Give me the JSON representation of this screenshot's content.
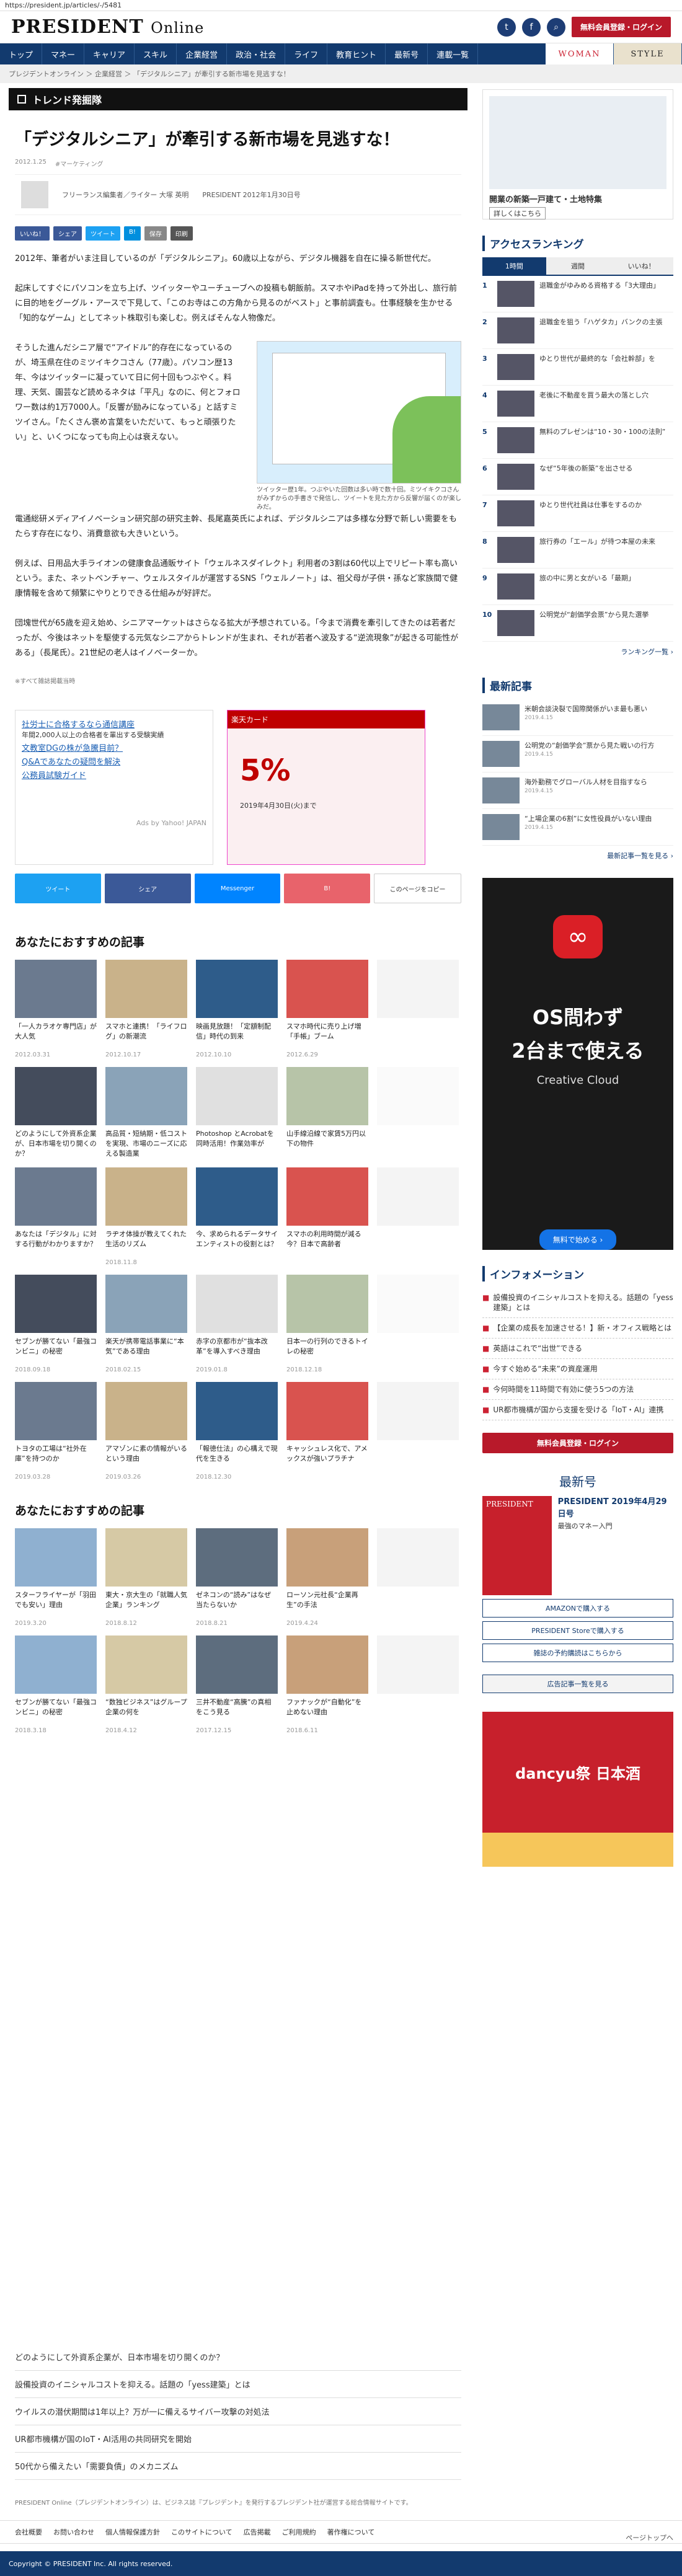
{
  "url": "https://president.jp/articles/-/5481",
  "header": {
    "logo": "PRESIDENT",
    "logo_sub": "Online",
    "login_label": "無料会員登録・ログイン"
  },
  "nav": {
    "items": [
      "トップ",
      "マネー",
      "キャリア",
      "スキル",
      "企業経営",
      "政治・社会",
      "ライフ",
      "教育ヒント",
      "最新号",
      "連載一覧"
    ],
    "woman": "WOMAN",
    "style": "STYLE"
  },
  "breadcrumb": "プレジデントオンライン ＞ 企業経営 ＞ 「デジタルシニア」が牽引する新市場を見逃すな！",
  "section_label": "トレンド発掘隊",
  "article": {
    "title": "「デジタルシニア」が牽引する新市場を見逃すな！",
    "date": "2012.1.25",
    "category": "#マーケティング",
    "author": "フリーランス編集者／ライター 大塚 英明",
    "source": "PRESIDENT 2012年1月30日号",
    "share": [
      "いいね！",
      "シェア",
      "ツイート",
      "B!",
      "保存",
      "印刷"
    ],
    "paragraphs": [
      "2012年、筆者がいま注目しているのが「デジタルシニア」。60歳以上ながら、デジタル機器を自在に操る新世代だ。",
      "起床してすぐにパソコンを立ち上げ、ツイッターやユーチューブへの投稿も朝飯前。スマホやiPadを持って外出し、旅行前に目的地をグーグル・アースで下見して、「このお寺はこの方角から見るのがベスト」と事前調査も。仕事経験を生かせる「知的なゲーム」としてネット株取引も楽しむ。例えばそんな人物像だ。",
      "そうした進んだシニア層で“アイドル”的存在になっているのが、埼玉県在住のミツイキクコさん（77歳）。パソコン歴13年、今はツイッターに凝っていて日に何十回もつぶやく。料理、天気、園芸など読めるネタは「平凡」なのに、何とフォロワー数は約1万7000人。「反響が励みになっている」と話すミツイさん。「たくさん褒め言葉をいただいて、もっと頑張りたい」と、いくつになっても向上心は衰えない。",
      "電通総研メディアイノベーション研究部の研究主幹、長尾嘉英氏によれば、デジタルシニアは多様な分野で新しい需要をもたらす存在になり、消費意欲も大きいという。",
      "例えば、日用品大手ライオンの健康食品通販サイト「ウェルネスダイレクト」利用者の3割は60代以上でリピート率も高いという。また、ネットベンチャー、ウェルスタイルが運営するSNS「ウェルノート」は、祖父母が子供・孫など家族間で健康情報を含めて頻繁にやりとりできる仕組みが好評だ。",
      "団塊世代が65歳を迎え始め、シニアマーケットはさらなる拡大が予想されている。「今まで消費を牽引してきたのは若者だったが、今後はネットを駆使する元気なシニアからトレンドが生まれ、それが若者へ波及する“逆流現象”が起きる可能性がある」（長尾氏）。21世紀の老人はイノベーターか。"
    ],
    "figure_caption": "ツイッター歴1年。つぶやいた回数は多い時で数十回。ミツイキクコさんがみずからの手書きで発信し、ツイートを見た方から反響が届くのが楽しみだ。",
    "note": "※すべて雑誌掲載当時"
  },
  "ads": {
    "ad1_lines": [
      "社労士に合格するなら通信講座",
      "年間2,000人以上の合格者を輩出する受験実績",
      "文教室DGの株が急騰目前？",
      "Q&Aであなたの疑問を解決",
      "公務員試験ガイド",
      "Ads by Yahoo! JAPAN"
    ],
    "ad2_title": "楽天カード",
    "ad2_offer": "5%",
    "ad2_date": "2019年4月30日(火)まで"
  },
  "sharebar": [
    "ツイート",
    "シェア",
    "Messenger",
    "B!",
    "このページをコピー"
  ],
  "rec1": {
    "title": "あなたにおすすめの記事",
    "cards": [
      {
        "t": "「一人カラオケ専門店」が大人気",
        "d": "2012.03.31"
      },
      {
        "t": "スマホと連携！「ライフログ」の新潮流",
        "d": "2012.10.17"
      },
      {
        "t": "映画見放題！「定額制配信」時代の到来",
        "d": "2012.10.10"
      },
      {
        "t": "スマホ時代に売り上げ増「手帳」ブーム",
        "d": "2012.6.29"
      },
      {
        "t": "",
        "d": ""
      },
      {
        "t": "どのようにして外資系企業が、日本市場を切り開くのか？",
        "d": ""
      },
      {
        "t": "高品質・短納期・低コストを実現、市場のニーズに応える製造業",
        "d": ""
      },
      {
        "t": "Photoshop とAcrobatを同時活用！作業効率が",
        "d": ""
      },
      {
        "t": "山手線沿線で家賃5万円以下の物件",
        "d": ""
      },
      {
        "t": "",
        "d": ""
      },
      {
        "t": "あなたは「デジタル」に対する行動がわかりますか？",
        "d": ""
      },
      {
        "t": "ラヂオ体操が教えてくれた生活のリズム",
        "d": "2018.11.8"
      },
      {
        "t": "今、求められるデータサイエンティストの役割とは？",
        "d": ""
      },
      {
        "t": "スマホの利用時間が減る今？日本で高齢者",
        "d": ""
      },
      {
        "t": "",
        "d": ""
      },
      {
        "t": "セブンが勝てない「最強コンビニ」の秘密",
        "d": "2018.09.18"
      },
      {
        "t": "楽天が携帯電話事業に“本気”である理由",
        "d": "2018.02.15"
      },
      {
        "t": "赤字の京都市が“抜本改革”を導入すべき理由",
        "d": "2019.01.8"
      },
      {
        "t": "日本一の行列のできるトイレの秘密",
        "d": "2018.12.18"
      },
      {
        "t": "",
        "d": ""
      },
      {
        "t": "トヨタの工場は“社外在庫”を持つのか",
        "d": "2019.03.28"
      },
      {
        "t": "アマゾンに素の情報がいるという理由",
        "d": "2019.03.26"
      },
      {
        "t": "「報徳仕法」の心構えで現代を生きる",
        "d": "2018.12.30"
      },
      {
        "t": "キャッシュレス化で、アメックスが強いプラチナ",
        "d": ""
      },
      {
        "t": "",
        "d": ""
      }
    ]
  },
  "rec2": {
    "title": "あなたにおすすめの記事",
    "cards": [
      {
        "t": "スターフライヤーが「羽田でも安い」理由",
        "d": "2019.3.20"
      },
      {
        "t": "東大・京大生の「就職人気企業」ランキング",
        "d": "2018.8.12"
      },
      {
        "t": "ゼネコンの“読み”はなぜ当たらないか",
        "d": "2018.8.21"
      },
      {
        "t": "ローソン元社長“企業再生”の手法",
        "d": "2019.4.24"
      },
      {
        "t": "",
        "d": ""
      },
      {
        "t": "セブンが勝てない「最強コンビニ」の秘密",
        "d": "2018.3.18"
      },
      {
        "t": "“数独ビジネス”はグループ企業の何を",
        "d": "2018.4.12"
      },
      {
        "t": "三井不動産“高騰”の真相をこう見る",
        "d": "2017.12.15"
      },
      {
        "t": "ファナックが“自動化”を止めない理由",
        "d": "2018.6.11"
      },
      {
        "t": "",
        "d": ""
      }
    ]
  },
  "side": {
    "ad_title": "開業の新築一戸建て・土地特集",
    "ad_btn": "詳しくはこちら",
    "ranking_title": "アクセスランキング",
    "tabs": [
      "1時間",
      "週間",
      "いいね！"
    ],
    "ranking": [
      "退職金がゆみめる資格する「3大理由」",
      "退職金を狙う「ハゲタカ」バンクの主張",
      "ゆとり世代が最終的な「会社幹部」を",
      "老後に不動産を買う最大の落とし穴",
      "無料のプレゼンは“10・30・100の法則”",
      "なぜ“5年後の新築”を出させる",
      "ゆとり世代社員は仕事をするのか",
      "旅行券の「エール」が待つ本屋の未来",
      "旅の中に男と女がいる「最期」",
      "公明党が“創価学会票”から見た選挙"
    ],
    "ranking_more": "ランキング一覧 ›",
    "latest_title": "最新記事",
    "news": [
      {
        "t": "米朝会談決裂で国際関係がいま最も悪い",
        "d": "2019.4.15"
      },
      {
        "t": "公明党の“創価学会”票から見た戦いの行方",
        "d": "2019.4.15"
      },
      {
        "t": "海外勤務でグローバル人材を目指すなら",
        "d": "2019.4.15"
      },
      {
        "t": "“上場企業の6割”に女性役員がいない理由",
        "d": "2019.4.15"
      }
    ],
    "news_more": "最新記事一覧を見る ›",
    "cc_line1": "OS問わず",
    "cc_line2": "2台まで使える",
    "cc_line3": "Creative Cloud",
    "cc_btn": "無料で始める ›",
    "info_title": "インフォメーション",
    "info": [
      "設備投資のイニシャルコストを抑える。話題の「yess建築」とは",
      "【企業の成長を加速させる！】新・オフィス戦略とは",
      "英語はこれで“出世”できる",
      "今すぐ始める“未来”の資産運用",
      "今何時間を11時間で有効に使う5つの方法",
      "UR都市機構が国から支援を受ける「IoT・AI」連携"
    ],
    "info_btn": "無料会員登録・ログイン",
    "magazine_head": "最新号",
    "magazine_title": "PRESIDENT 2019年4月29日号",
    "magazine_sub": "最強のマネー入門",
    "mag_buttons": [
      "AMAZONで購入する",
      "PRESIDENT Storeで購入する",
      "雑誌の予約購読はこちらから"
    ],
    "ad_list_btn": "広告記事一覧を見る",
    "dancyu": "dancyu祭 日本酒"
  },
  "bottom_links": [
    "どのようにして外資系企業が、日本市場を切り開くのか？",
    "設備投資のイニシャルコストを抑える。話題の「yess建築」とは",
    "ウイルスの潜伏期間は1年以上？万が一に備えるサイバー攻撃の対処法",
    "UR都市機構が国のIoT・AI活用の共同研究を開始",
    "50代から備えたい「需要負債」のメカニズム"
  ],
  "footer": {
    "text": "PRESIDENT Online（プレジデントオンライン）は、ビジネス誌『プレジデント』を発行するプレジデント社が運営する総合情報サイトです。",
    "links": [
      "会社概要",
      "お問い合わせ",
      "個人情報保護方針",
      "このサイトについて",
      "広告掲載",
      "ご利用規約",
      "著作権について",
      "ページトップへ"
    ],
    "pagetop": "ページトップへ",
    "copyright": "Copyright © PRESIDENT Inc. All rights reserved."
  }
}
